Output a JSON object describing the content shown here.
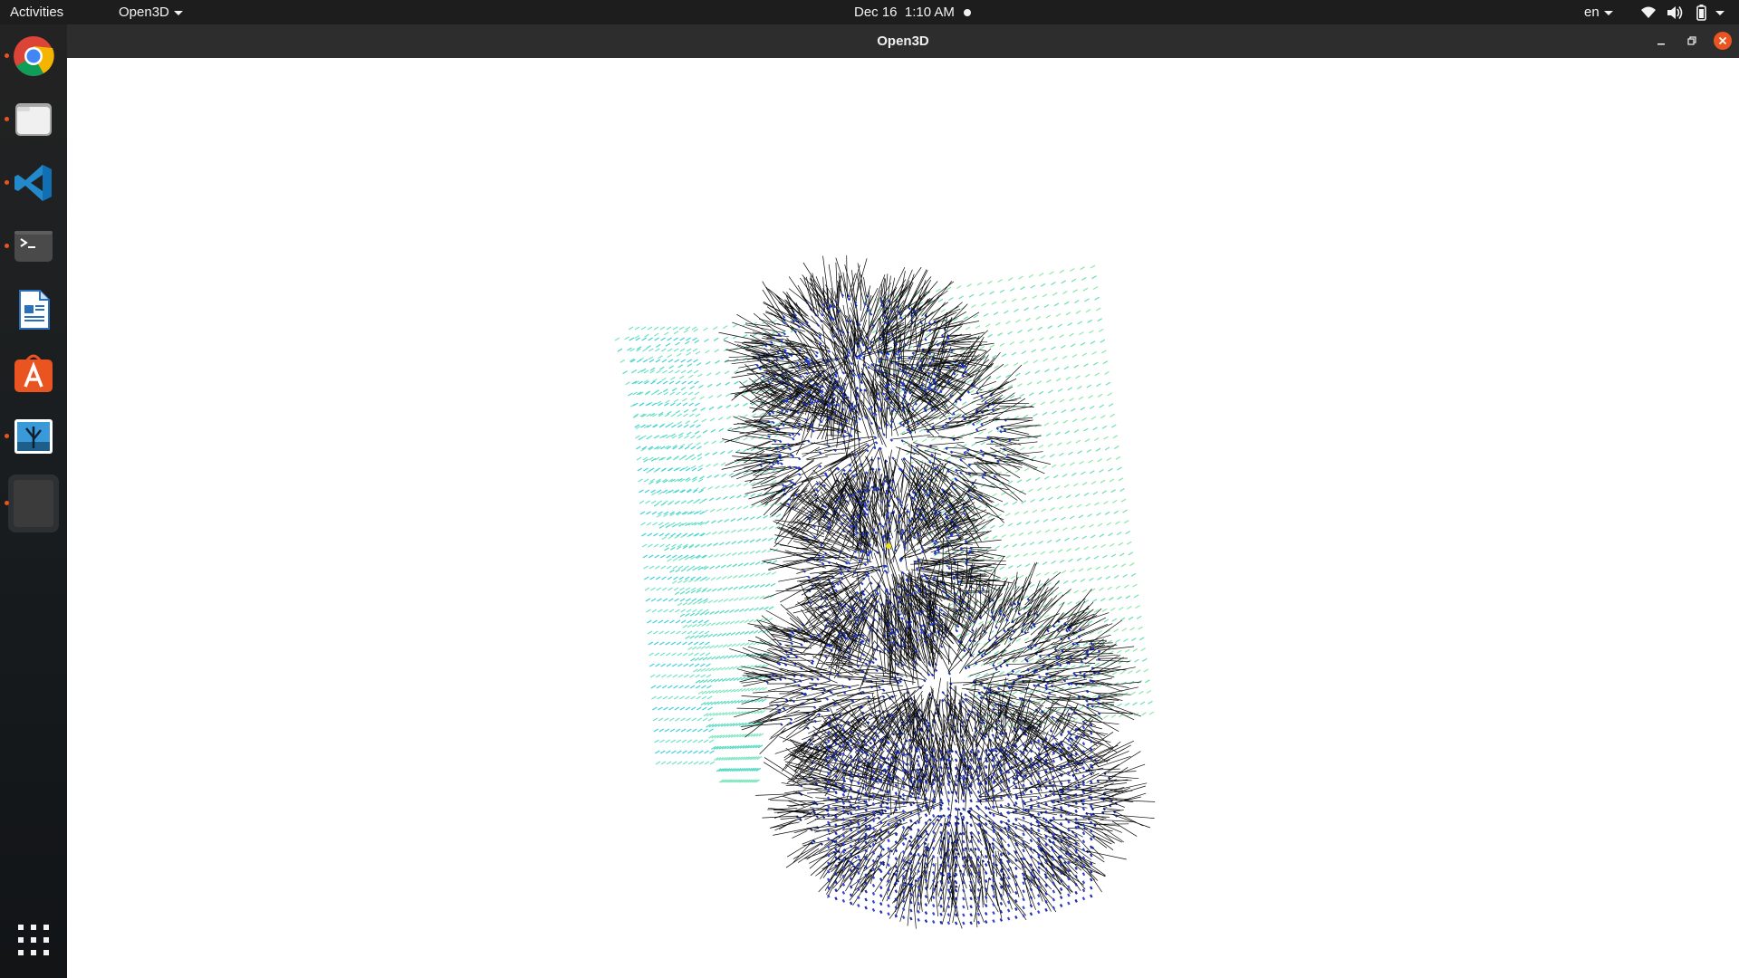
{
  "topbar": {
    "activities": "Activities",
    "app_menu": "Open3D",
    "date": "Dec 16",
    "time": "1:10 AM",
    "language": "en"
  },
  "window": {
    "title": "Open3D"
  },
  "dock": {
    "items": [
      {
        "name": "Google Chrome",
        "icon": "chrome-icon",
        "running": true
      },
      {
        "name": "Files",
        "icon": "files-icon",
        "running": true
      },
      {
        "name": "Visual Studio Code",
        "icon": "vscode-icon",
        "running": true
      },
      {
        "name": "Terminal",
        "icon": "terminal-icon",
        "running": true
      },
      {
        "name": "LibreOffice Writer",
        "icon": "writer-icon",
        "running": false
      },
      {
        "name": "Ubuntu Software",
        "icon": "software-icon",
        "running": false
      },
      {
        "name": "Image Viewer",
        "icon": "image-viewer-icon",
        "running": true
      },
      {
        "name": "Open3D",
        "icon": "open3d-window-icon",
        "running": true
      }
    ],
    "show_apps": "show-applications-icon"
  },
  "colors": {
    "accent": "#e95420",
    "close_button": "#e95420",
    "topbar_bg": "#1d1d1d",
    "titlebar_bg": "#2d2d2d",
    "viewport_bg": "#ffffff",
    "normals": "#000000",
    "points_blue": "#1f3bd6",
    "points_green": "#6fe0b0",
    "points_cyan": "#49d8cf"
  },
  "scene": {
    "description_icon": "point-cloud-with-normals",
    "selected_point_color": "#f0e020"
  }
}
